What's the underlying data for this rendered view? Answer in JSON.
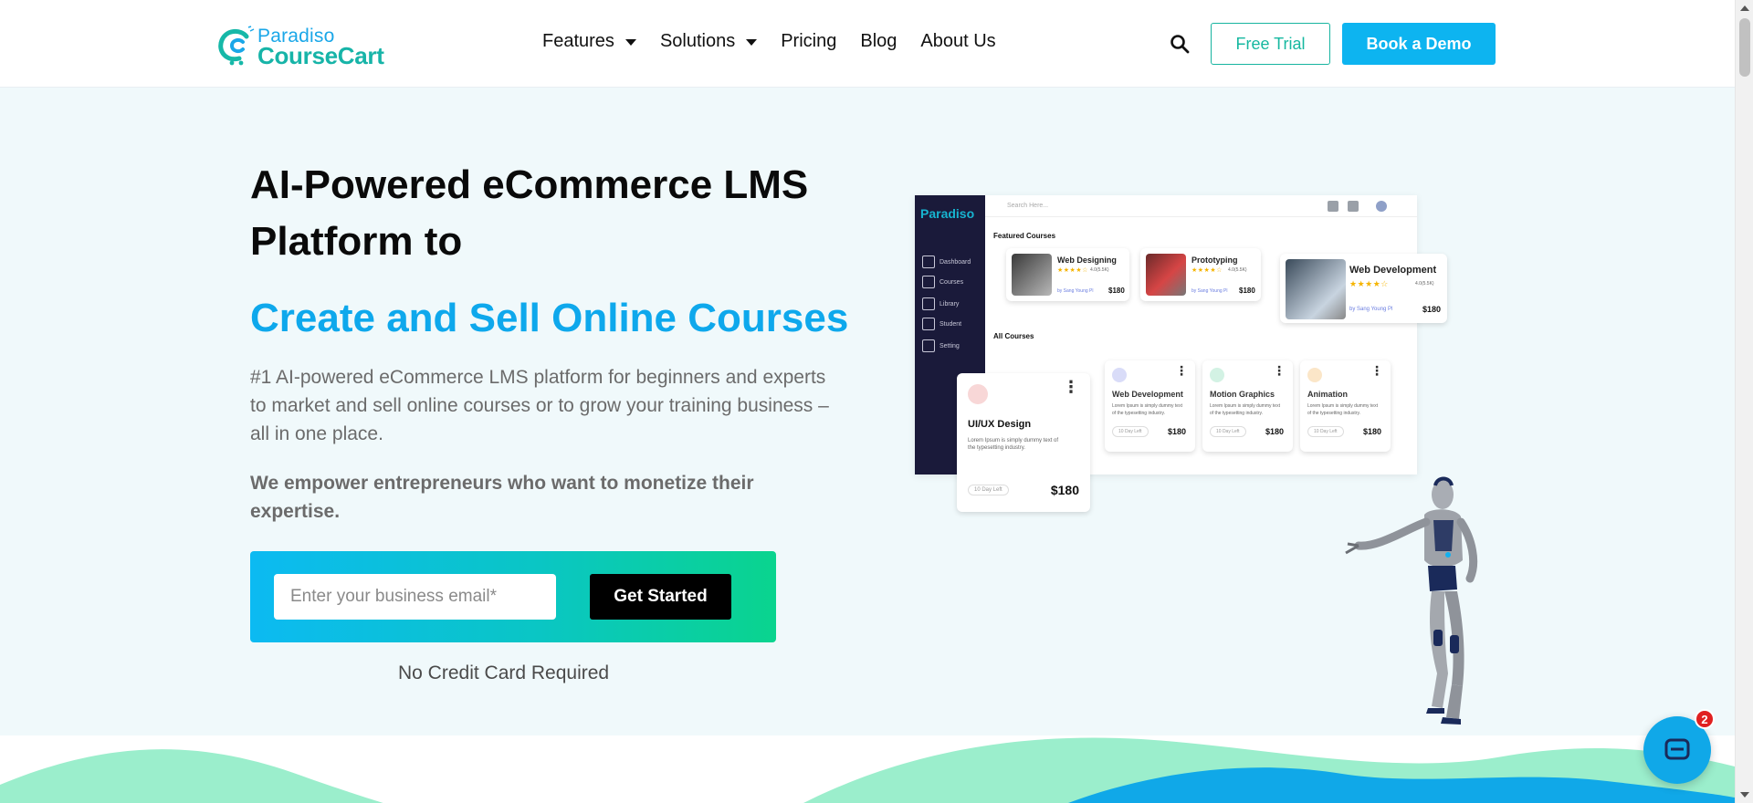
{
  "header": {
    "logo": {
      "top": "Paradiso",
      "bottom": "CourseCart"
    },
    "nav": [
      {
        "label": "Features",
        "dropdown": true
      },
      {
        "label": "Solutions",
        "dropdown": true
      },
      {
        "label": "Pricing",
        "dropdown": false
      },
      {
        "label": "Blog",
        "dropdown": false
      },
      {
        "label": "About Us",
        "dropdown": false
      }
    ],
    "search_icon": "search-icon",
    "free_trial_label": "Free Trial",
    "book_demo_label": "Book a Demo"
  },
  "hero": {
    "title": "AI-Powered eCommerce LMS Platform to",
    "subtitle": "Create and Sell Online Courses",
    "description": "#1 AI-powered eCommerce LMS platform for beginners and experts to market and sell online courses or to grow your training business – all in one place.",
    "emphasis": "We empower entrepreneurs who want to monetize their expertise.",
    "email_placeholder": "Enter your business email*",
    "cta_label": "Get Started",
    "note": "No Credit Card Required"
  },
  "mockup": {
    "logo": "Paradiso",
    "search_placeholder": "Search Here...",
    "sidebar": [
      "Dashboard",
      "Courses",
      "Library",
      "Student",
      "Setting"
    ],
    "featured_title": "Featured Courses",
    "all_title": "All Courses",
    "featured": [
      {
        "title": "Web Designing",
        "price": "$180",
        "reviews": "4.0(5.5K)",
        "by": "by Sang Young Pl"
      },
      {
        "title": "Prototyping",
        "price": "$180",
        "reviews": "4.0(5.5K)",
        "by": "by Sang Young Pl"
      },
      {
        "title": "Web Development",
        "price": "$180",
        "reviews": "4.0(5.5K)",
        "by": "by Sang Young Pl"
      }
    ],
    "all": [
      {
        "title": "UI/UX Design",
        "price": "$180",
        "days": "10 Day Left",
        "text": "Lorem Ipsum is simply dummy text of the typesetting industry.",
        "icon_color": "#f8d7d7"
      },
      {
        "title": "Web Development",
        "price": "$180",
        "days": "10 Day Left",
        "text": "Lorem Ipsum is simply dummy text of the typesetting industry.",
        "icon_color": "#d9dcf8"
      },
      {
        "title": "Motion Graphics",
        "price": "$180",
        "days": "10 Day Left",
        "text": "Lorem Ipsum is simply dummy text of the typesetting industry.",
        "icon_color": "#d3f2e4"
      },
      {
        "title": "Animation",
        "price": "$180",
        "days": "10 Day Left",
        "text": "Lorem Ipsum is simply dummy text of the typesetting industry.",
        "icon_color": "#fbe6c8"
      }
    ]
  },
  "chat": {
    "badge": "2"
  },
  "colors": {
    "brand_blue": "#0db4f0",
    "brand_teal": "#17b4a0",
    "hero_bg": "#f0f9fb",
    "subtitle": "#0ea8ec"
  }
}
